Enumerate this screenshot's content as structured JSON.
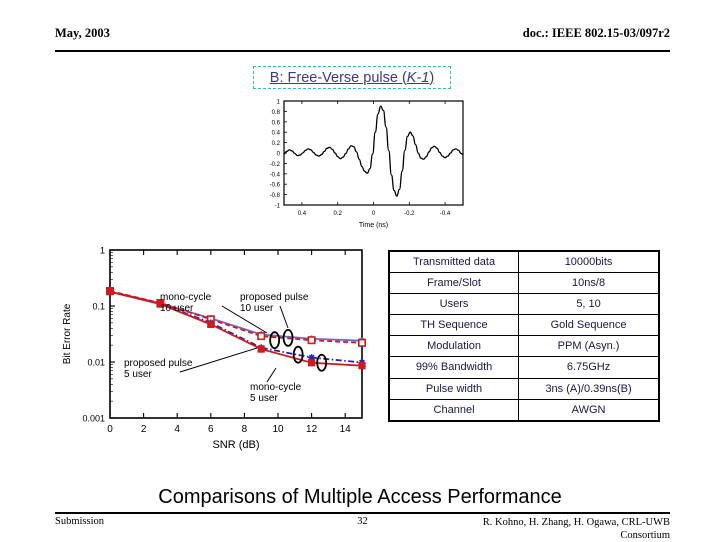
{
  "header": {
    "date": "May, 2003",
    "doc": "doc.: IEEE 802.15-03/097r2"
  },
  "slide": {
    "title_prefix": "B: Free-Verse pulse (",
    "title_italic": "K-1",
    "title_suffix": ")",
    "title_full": "B: Free-Verse pulse (K-1)",
    "title_border_color": "#2fb8c8",
    "title_text_color": "#3a3a93",
    "caption": "Comparisons of Multiple Access Performance"
  },
  "footer": {
    "left": "Submission",
    "page": "32",
    "right_line1": "R. Kohno, H. Zhang, H. Ogawa, CRL-UWB",
    "right_line2": "Consortium"
  },
  "params": {
    "rows": [
      {
        "name": "Transmitted data",
        "value": "10000bits"
      },
      {
        "name": "Frame/Slot",
        "value": "10ns/8"
      },
      {
        "name": "Users",
        "value": "5, 10"
      },
      {
        "name": "TH Sequence",
        "value": "Gold Sequence"
      },
      {
        "name": "Modulation",
        "value": "PPM (Asyn.)"
      },
      {
        "name": "99% Bandwidth",
        "value": "6.75GHz"
      },
      {
        "name": "Pulse width",
        "value": "3ns (A)/0.39ns(B)"
      },
      {
        "name": "Channel",
        "value": "AWGN"
      }
    ]
  },
  "chart_data": [
    {
      "id": "pulse-waveform",
      "type": "line",
      "title": "",
      "xlabel": "Time (ns)",
      "ylabel": "",
      "xlim": [
        0.5,
        -0.5
      ],
      "ylim": [
        -1,
        1
      ],
      "xticks": [
        "0.4",
        "0.2",
        "0",
        "-0.2",
        "-0.4"
      ],
      "xtick_values": [
        0.4,
        0.2,
        0,
        -0.2,
        -0.4
      ],
      "yticks": [
        "1",
        "0.8",
        "0.6",
        "0.4",
        "0.2",
        "0",
        "-0.2",
        "-0.4",
        "-0.6",
        "-0.8",
        "-1"
      ],
      "ytick_values": [
        1,
        0.8,
        0.6,
        0.4,
        0.2,
        0,
        -0.2,
        -0.4,
        -0.6,
        -0.8,
        -1
      ],
      "grid": false,
      "legend": "none",
      "line_color": "#000000",
      "series": [
        {
          "name": "Free-Verse pulse",
          "x": [
            0.5,
            0.485,
            0.47,
            0.455,
            0.44,
            0.425,
            0.41,
            0.395,
            0.38,
            0.365,
            0.35,
            0.335,
            0.32,
            0.305,
            0.29,
            0.275,
            0.26,
            0.245,
            0.23,
            0.215,
            0.2,
            0.185,
            0.17,
            0.155,
            0.14,
            0.125,
            0.11,
            0.095,
            0.08,
            0.065,
            0.05,
            0.035,
            0.02,
            0.005,
            -0.01,
            -0.025,
            -0.04,
            -0.055,
            -0.07,
            -0.085,
            -0.1,
            -0.115,
            -0.13,
            -0.145,
            -0.16,
            -0.175,
            -0.19,
            -0.205,
            -0.22,
            -0.235,
            -0.25,
            -0.265,
            -0.28,
            -0.295,
            -0.31,
            -0.325,
            -0.34,
            -0.355,
            -0.37,
            -0.385,
            -0.4,
            -0.415,
            -0.43,
            -0.445,
            -0.46,
            -0.475,
            -0.49,
            -0.5
          ],
          "y": [
            -0.02,
            0.03,
            0.06,
            0.04,
            -0.01,
            -0.05,
            -0.04,
            0.0,
            0.05,
            0.08,
            0.06,
            0.01,
            -0.04,
            -0.06,
            -0.03,
            0.03,
            0.09,
            0.11,
            0.07,
            0.0,
            -0.07,
            -0.11,
            -0.08,
            -0.01,
            0.08,
            0.14,
            0.12,
            0.02,
            -0.12,
            -0.26,
            -0.35,
            -0.39,
            -0.3,
            -0.02,
            0.4,
            0.75,
            0.9,
            0.82,
            0.5,
            0.05,
            -0.42,
            -0.72,
            -0.83,
            -0.7,
            -0.35,
            0.05,
            0.32,
            0.4,
            0.33,
            0.16,
            0.0,
            -0.1,
            -0.12,
            -0.07,
            0.02,
            0.1,
            0.13,
            0.09,
            0.01,
            -0.06,
            -0.09,
            -0.06,
            0.0,
            0.06,
            0.08,
            0.05,
            -0.01,
            -0.03
          ]
        }
      ]
    },
    {
      "id": "ber-vs-snr",
      "type": "line",
      "title": "",
      "xlabel": "SNR (dB)",
      "ylabel": "Bit Error Rate",
      "xlim": [
        0,
        15
      ],
      "ylim": [
        0.001,
        1
      ],
      "yscale": "log",
      "xticks": [
        "0",
        "2",
        "4",
        "6",
        "8",
        "10",
        "12",
        "14"
      ],
      "xtick_values": [
        0,
        2,
        4,
        6,
        8,
        10,
        12,
        14
      ],
      "yticks": [
        "1",
        "0.1",
        "0.01",
        "0.001"
      ],
      "ytick_values": [
        1,
        0.1,
        0.01,
        0.001
      ],
      "grid": false,
      "legend": "annotations",
      "x": [
        0,
        3,
        6,
        9,
        12,
        15
      ],
      "series": [
        {
          "name": "mono-cycle 10 user",
          "color": "#6a6ad0",
          "dash": "solid",
          "marker": "star",
          "values": [
            0.18,
            0.112,
            0.06,
            0.031,
            0.026,
            0.024
          ]
        },
        {
          "name": "proposed pulse 10 user",
          "color": "#d11a1a",
          "dash": "dashed",
          "marker": "open-square",
          "values": [
            0.185,
            0.113,
            0.058,
            0.029,
            0.0245,
            0.022
          ]
        },
        {
          "name": "mono-cycle 5 user",
          "color": "#2222b5",
          "dash": "dash-dot",
          "marker": "star",
          "values": [
            0.18,
            0.11,
            0.05,
            0.018,
            0.012,
            0.0098
          ]
        },
        {
          "name": "proposed pulse 5 user",
          "color": "#d11a1a",
          "dash": "solid",
          "marker": "filled-square",
          "values": [
            0.18,
            0.108,
            0.047,
            0.017,
            0.0097,
            0.0086
          ]
        }
      ],
      "annotations": [
        {
          "id": "ann-mono-10",
          "line1": "mono-cycle",
          "line2": "10 user"
        },
        {
          "id": "ann-prop-10",
          "line1": "proposed pulse",
          "line2": "10 user"
        },
        {
          "id": "ann-prop-5",
          "line1": "proposed pulse",
          "line2": "5 user"
        },
        {
          "id": "ann-mono-5",
          "line1": "mono-cycle",
          "line2": "5 user"
        }
      ]
    }
  ]
}
